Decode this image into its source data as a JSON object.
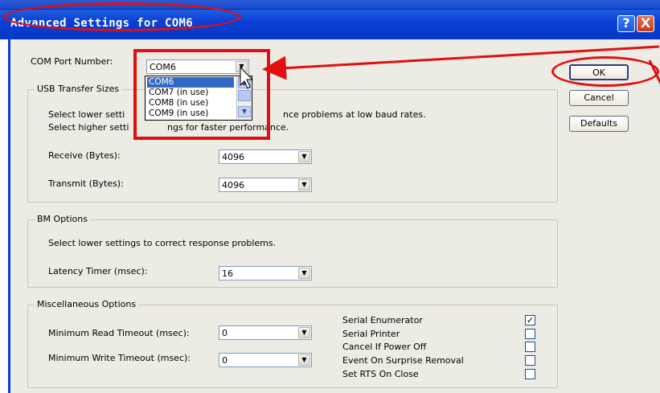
{
  "window": {
    "title": "Advanced Settings for COM6",
    "help_label": "?",
    "close_label": "X"
  },
  "com_port": {
    "label": "COM Port Number:",
    "value": "COM6",
    "options": [
      "COM6",
      "COM7 (in use)",
      "COM8 (in use)",
      "COM9 (in use)"
    ],
    "selected_index": 0
  },
  "usb": {
    "title": "USB Transfer Sizes",
    "line1_a": "Select lower setti",
    "line1_b": "nce problems at low baud rates.",
    "line2_a": "Select higher setti",
    "line2_b": "ngs for faster performance.",
    "receive_label": "Receive (Bytes):",
    "receive_value": "4096",
    "transmit_label": "Transmit (Bytes):",
    "transmit_value": "4096"
  },
  "bm": {
    "title": "BM Options",
    "desc": "Select lower settings to correct response problems.",
    "latency_label": "Latency Timer (msec):",
    "latency_value": "16"
  },
  "misc": {
    "title": "Miscellaneous Options",
    "min_read_label": "Minimum Read Timeout (msec):",
    "min_read_value": "0",
    "min_write_label": "Minimum Write Timeout (msec):",
    "min_write_value": "0",
    "checks": [
      {
        "label": "Serial Enumerator",
        "checked": true
      },
      {
        "label": "Serial Printer",
        "checked": false
      },
      {
        "label": "Cancel If Power Off",
        "checked": false
      },
      {
        "label": "Event On Surprise Removal",
        "checked": false
      },
      {
        "label": "Set RTS On Close",
        "checked": false
      }
    ]
  },
  "buttons": {
    "ok": "OK",
    "cancel": "Cancel",
    "defaults": "Defaults"
  },
  "colors": {
    "titlebar": "#0a3fd6",
    "annotation": "#e01010",
    "selection": "#316ac5"
  }
}
